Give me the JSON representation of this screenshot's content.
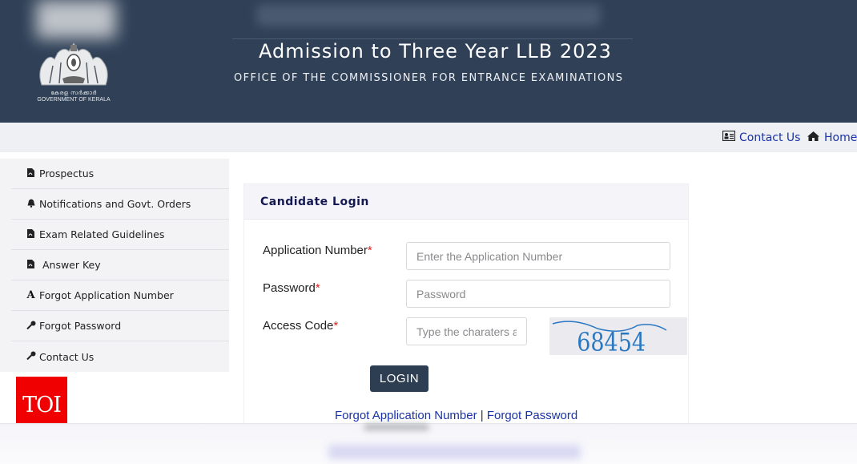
{
  "header": {
    "emblem_malayalam": "കേരള സർക്കാർ",
    "emblem_english": "GOVERNMENT OF KERALA",
    "title": "Admission to Three Year LLB 2023",
    "subtitle": "OFFICE OF THE COMMISSIONER FOR ENTRANCE EXAMINATIONS"
  },
  "topbar": {
    "contact_icon": "address-card-icon",
    "contact_label": "Contact Us",
    "home_icon": "home-icon",
    "home_label": "Home"
  },
  "sidebar": {
    "items": [
      {
        "icon": "pdf-file-icon",
        "glyph": "▙",
        "label": "Prospectus"
      },
      {
        "icon": "bell-icon",
        "glyph": "🔔",
        "label": "Notifications and Govt. Orders"
      },
      {
        "icon": "pdf-file-icon",
        "glyph": "▙",
        "label": "Exam Related Guidelines"
      },
      {
        "icon": "pdf-file-icon",
        "glyph": "▙",
        "label": " Answer Key"
      },
      {
        "icon": "font-icon",
        "glyph": "A",
        "label": "Forgot Application Number"
      },
      {
        "icon": "key-icon",
        "glyph": "⚷",
        "label": "Forgot Password"
      },
      {
        "icon": "key-icon",
        "glyph": "⚷",
        "label": "Contact Us"
      }
    ]
  },
  "watermark": {
    "text": "TOI",
    "color": "#f00000"
  },
  "login": {
    "title": "Candidate Login",
    "application_number_label": "Application Number",
    "application_number_placeholder": "Enter the Application Number",
    "application_number_value": "",
    "password_label": "Password",
    "password_placeholder": "Password",
    "password_value": "",
    "access_code_label": "Access Code",
    "access_code_placeholder": "Type the charaters above",
    "access_code_value": "",
    "required_mark": "*",
    "captcha_text": "68454",
    "login_button": "LOGIN",
    "forgot_app_link": "Forgot Application Number",
    "separator": "|",
    "forgot_password_link": "Forgot Password"
  },
  "colors": {
    "header_bg": "#2f4057",
    "link": "#1a33a8",
    "button_bg": "#2d3e52",
    "required": "#e02020",
    "captcha_ink": "#2a78c2"
  }
}
